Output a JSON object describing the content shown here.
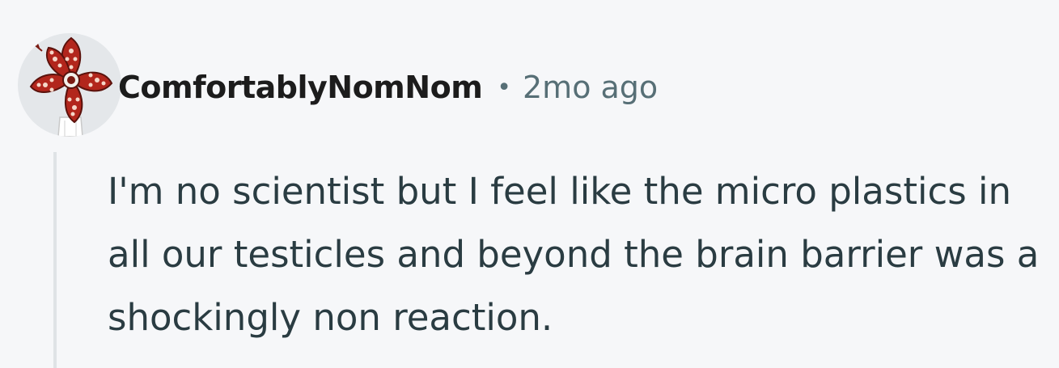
{
  "comment": {
    "author": "ComfortablyNomNom",
    "separator": "•",
    "timestamp": "2mo ago",
    "body": "I'm no scientist but I feel like the micro plastics in all our testicles and beyond the brain barrier was a shockingly non reaction."
  },
  "avatar": {
    "icon": "demogorgon-flower-icon",
    "petal_color": "#b2261c",
    "background_color": "#e4e7ea"
  },
  "colors": {
    "page_background": "#f6f7f9",
    "author_text": "#1c1c1c",
    "meta_text": "#576f76",
    "body_text": "#2a3c42",
    "thread_line": "#dfe3e6"
  }
}
